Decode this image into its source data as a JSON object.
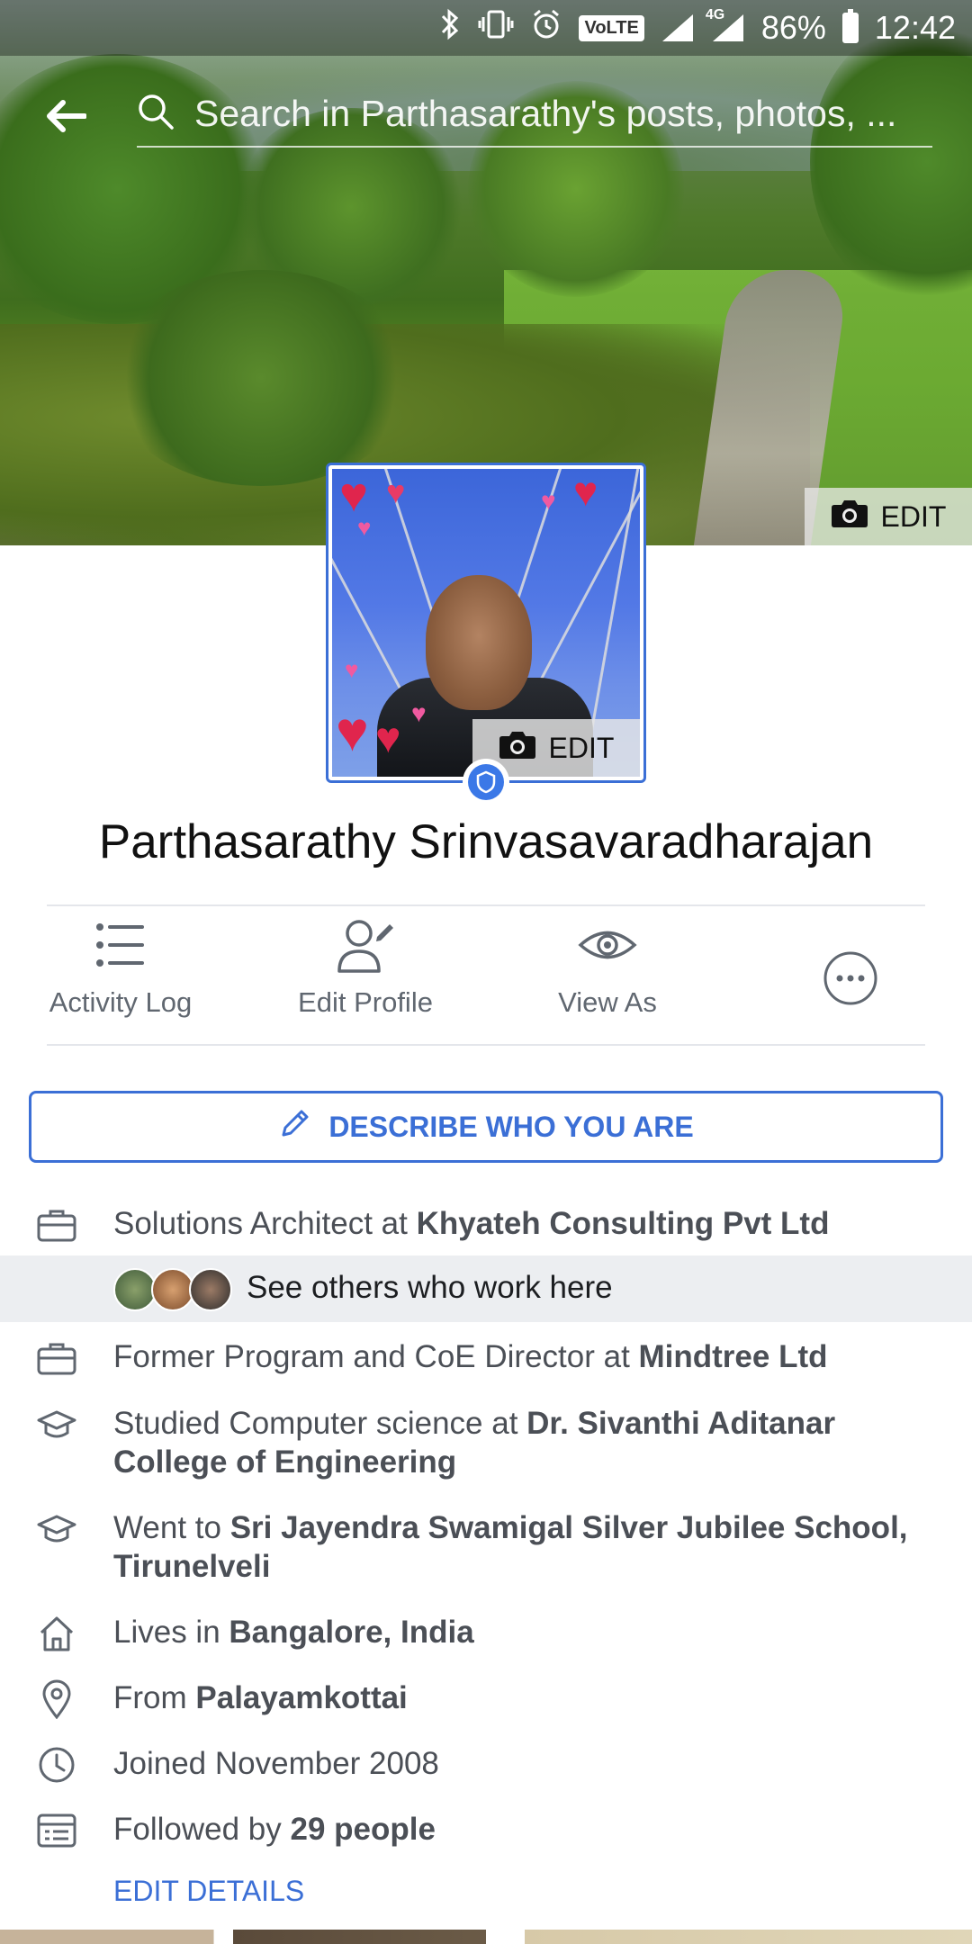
{
  "status_bar": {
    "battery": "86%",
    "time": "12:42",
    "network": "4G",
    "volte": "VoLTE"
  },
  "search": {
    "placeholder": "Search in Parthasarathy's posts, photos, ..."
  },
  "cover": {
    "edit_label": "EDIT"
  },
  "profile_picture": {
    "edit_label": "EDIT"
  },
  "profile": {
    "name": "Parthasarathy Srinvasavaradharajan"
  },
  "actions": [
    {
      "label": "Activity Log",
      "icon": "list-icon"
    },
    {
      "label": "Edit Profile",
      "icon": "edit-profile-icon"
    },
    {
      "label": "View As",
      "icon": "eye-icon"
    },
    {
      "label": "",
      "icon": "more-icon"
    }
  ],
  "describe_button": {
    "label": "DESCRIBE WHO YOU ARE"
  },
  "details": {
    "work": {
      "prefix": "Solutions Architect at ",
      "bold": "Khyateh Consulting Pvt Ltd"
    },
    "coworkers": {
      "label": "See others who work here"
    },
    "former_work": {
      "prefix": "Former Program and CoE Director at ",
      "bold": "Mindtree Ltd"
    },
    "college": {
      "prefix": "Studied Computer science at ",
      "bold": "Dr. Sivanthi Aditanar College of Engineering"
    },
    "school": {
      "prefix": "Went to ",
      "bold": "Sri Jayendra Swamigal Silver Jubilee School, Tirunelveli"
    },
    "lives": {
      "prefix": "Lives in ",
      "bold": "Bangalore, India"
    },
    "from": {
      "prefix": "From ",
      "bold": "Palayamkottai"
    },
    "joined": {
      "text": "Joined November 2008"
    },
    "followers": {
      "prefix": "Followed by ",
      "bold": "29 people"
    },
    "edit_details_label": "EDIT DETAILS"
  },
  "colors": {
    "accent": "#3b6fd6",
    "text_secondary": "#4b4f56"
  }
}
